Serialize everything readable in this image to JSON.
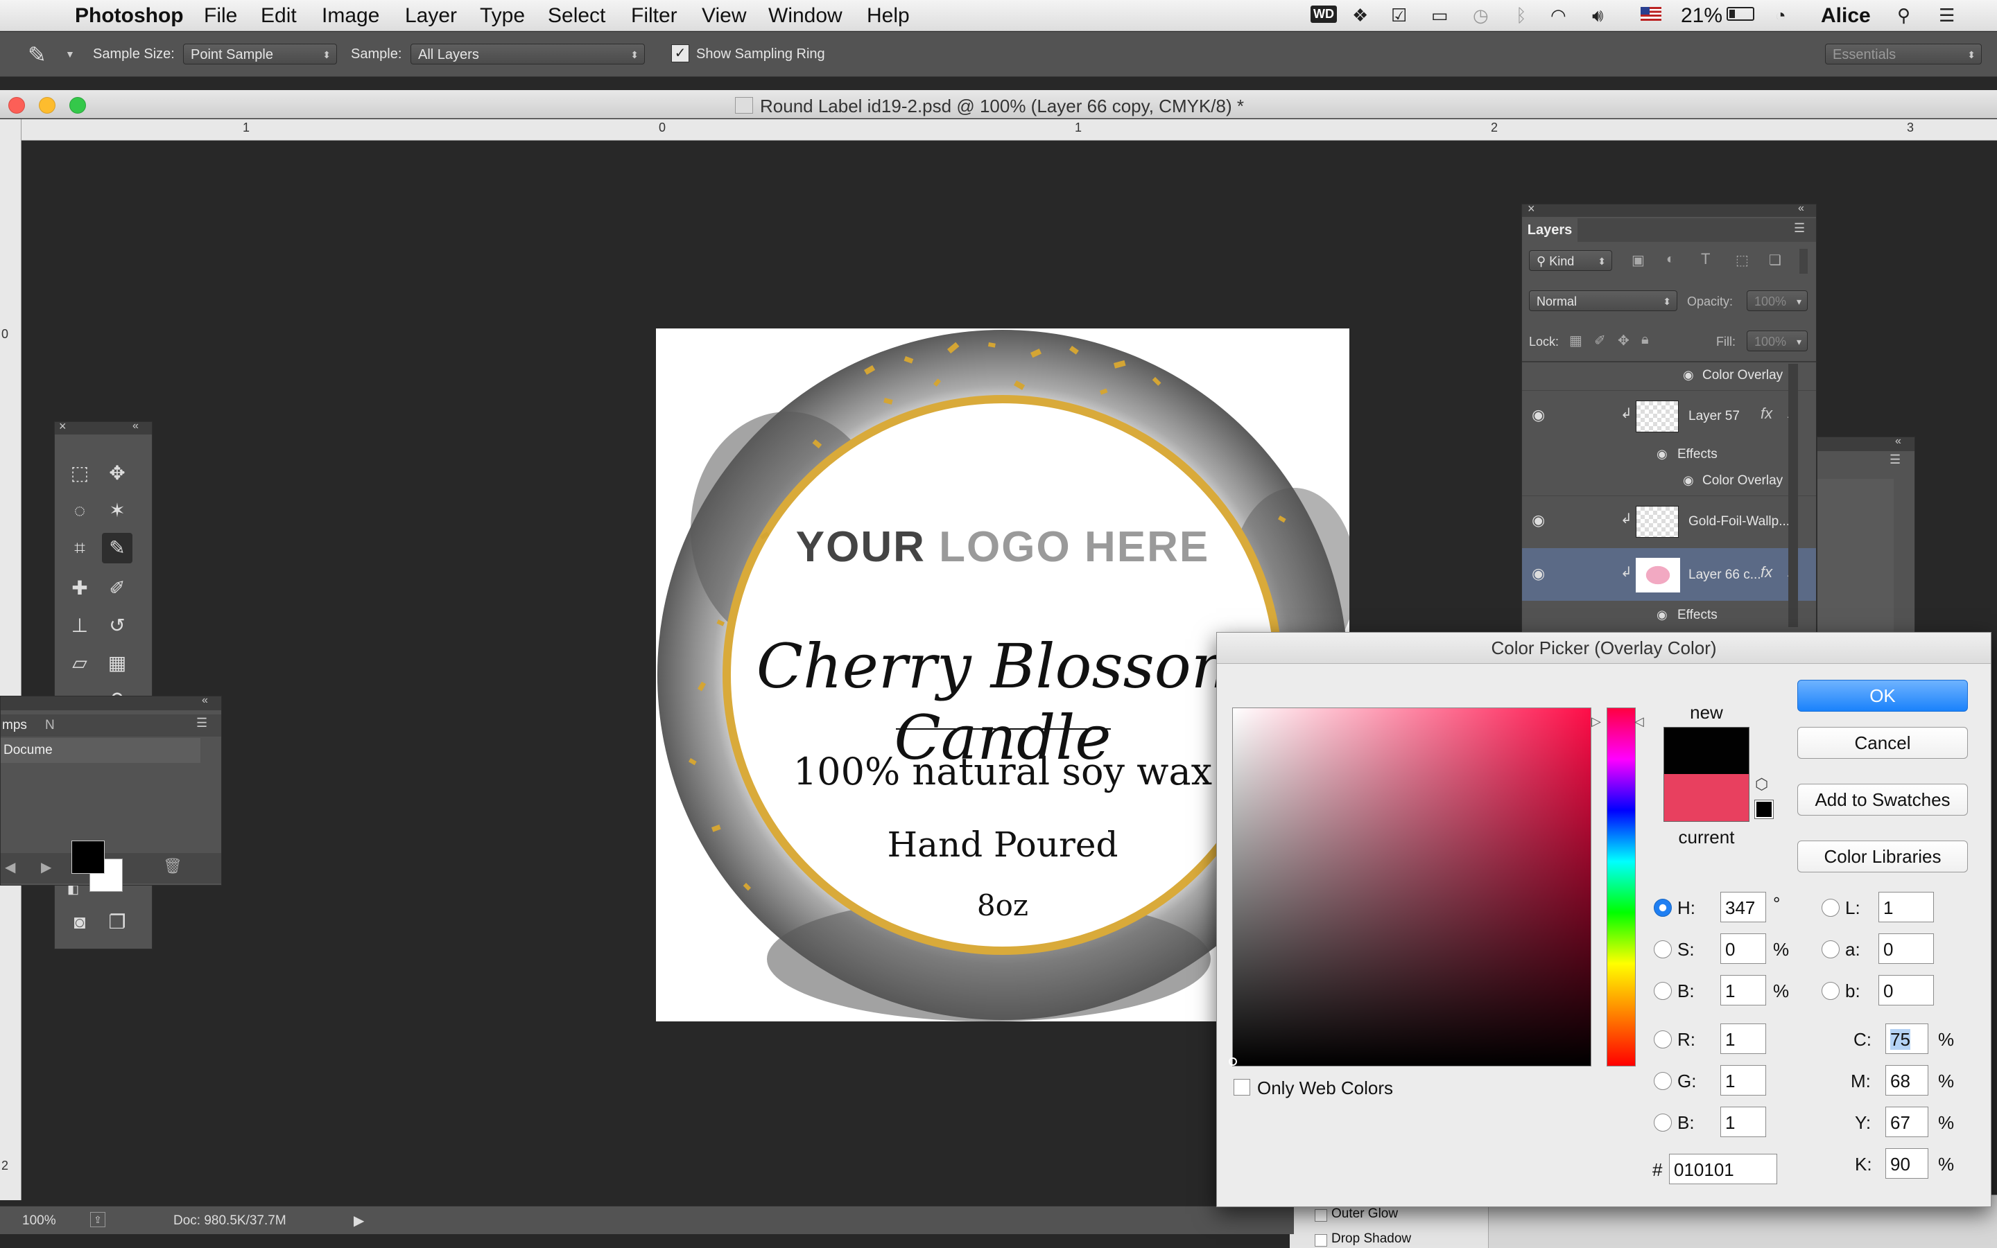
{
  "menubar": {
    "app": "Photoshop",
    "items": [
      "File",
      "Edit",
      "Image",
      "Layer",
      "Type",
      "Select",
      "Filter",
      "View",
      "Window",
      "Help"
    ],
    "battery": "21%",
    "user": "Alice"
  },
  "options": {
    "sample_size_label": "Sample Size:",
    "sample_size_value": "Point Sample",
    "sample_label": "Sample:",
    "sample_value": "All Layers",
    "show_ring_label": "Show Sampling Ring",
    "workspace": "Essentials"
  },
  "document": {
    "title": "Round Label id19-2.psd @ 100% (Layer 66 copy, CMYK/8) *"
  },
  "rulers": {
    "h": [
      "1",
      "0",
      "1",
      "2",
      "3"
    ],
    "v": [
      "0",
      "2"
    ]
  },
  "label": {
    "logo_dark": "YOUR",
    "logo_light": "LOGO HERE",
    "name": "Cherry Blossom Candle",
    "line1": "100% natural soy wax",
    "line2": "Hand Poured",
    "line3": "8oz"
  },
  "side_panel": {
    "tab1": "mps",
    "tab2": "N",
    "item": "Docume"
  },
  "layers": {
    "title": "Layers",
    "kind": "Kind",
    "blend": "Normal",
    "opacity_label": "Opacity:",
    "opacity": "100%",
    "lock_label": "Lock:",
    "fill_label": "Fill:",
    "fill": "100%",
    "rows": {
      "r0": "Color Overlay",
      "r1": "Layer 57",
      "r2": "Effects",
      "r3": "Color Overlay",
      "r4": "Gold-Foil-Wallp...",
      "r5": "Layer 66 c...",
      "r6": "Effects"
    },
    "fx": "fx"
  },
  "styles_panel": {
    "outer_glow": "Outer Glow",
    "drop_shadow": "Drop Shadow"
  },
  "picker": {
    "title": "Color Picker (Overlay Color)",
    "new_label": "new",
    "current_label": "current",
    "ok": "OK",
    "cancel": "Cancel",
    "add_swatches": "Add to Swatches",
    "libraries": "Color Libraries",
    "only_web": "Only Web Colors",
    "new_color": "#010101",
    "current_color": "#e8405f",
    "fields": {
      "H": "347",
      "S": "0",
      "B": "1",
      "R": "1",
      "G": "1",
      "B2": "1",
      "L": "1",
      "a": "0",
      "b": "0",
      "C": "75",
      "M": "68",
      "Y": "67",
      "K": "90",
      "hex": "010101"
    },
    "labels": {
      "H": "H:",
      "S": "S:",
      "B": "B:",
      "R": "R:",
      "G": "G:",
      "B2": "B:",
      "L": "L:",
      "a": "a:",
      "b": "b:",
      "C": "C:",
      "M": "M:",
      "Y": "Y:",
      "K": "K:",
      "hash": "#"
    },
    "units": {
      "deg": "°",
      "pct": "%"
    }
  },
  "status": {
    "zoom": "100%",
    "doc": "Doc: 980.5K/37.7M"
  },
  "colors": {
    "panel": "#535353",
    "selection": "#2e6bd9",
    "accent": "#1a82fb",
    "gold": "#d9aa3a"
  }
}
